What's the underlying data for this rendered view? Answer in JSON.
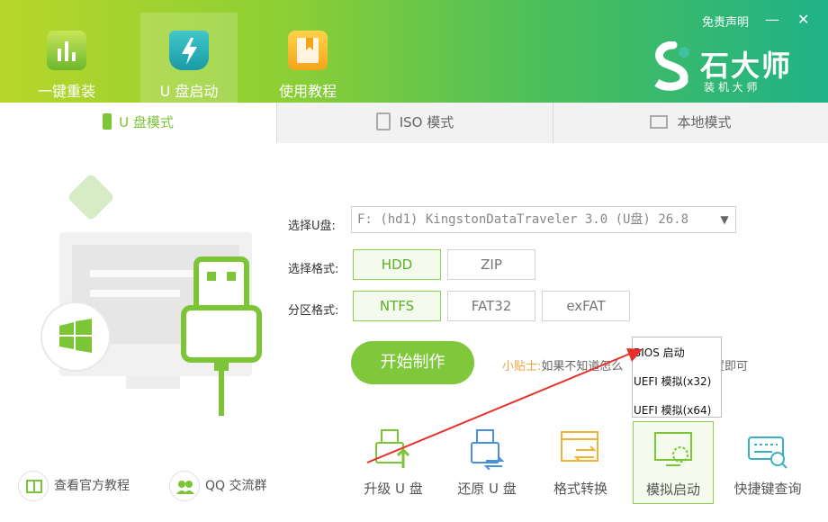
{
  "header": {
    "nav_tabs": [
      {
        "label": "一键重装"
      },
      {
        "label": "U 盘启动"
      },
      {
        "label": "使用教程"
      }
    ],
    "disclaimer": "免责声明",
    "minimize_glyph": "—",
    "close_glyph": "✕",
    "brand_name": "石大师",
    "brand_sub": "装 机 大 师"
  },
  "mode_tabs": [
    {
      "label": "U 盘模式"
    },
    {
      "label": "ISO 模式"
    },
    {
      "label": "本地模式"
    }
  ],
  "form": {
    "drive_label": "选择U盘:",
    "drive_value": "F: (hd1) KingstonDataTraveler 3.0 (U盘) 26.8",
    "format_label": "选择格式:",
    "format_options": [
      "HDD",
      "ZIP"
    ],
    "partition_label": "分区格式:",
    "partition_options": [
      "NTFS",
      "FAT32",
      "exFAT"
    ]
  },
  "start_button": "开始制作",
  "tip": {
    "label": "小贴士:",
    "text": "如果不知道怎么",
    "text_tail": "置即可"
  },
  "dropdown": {
    "items": [
      "BIOS 启动",
      "UEFI 模拟(x32)",
      "UEFI 模拟(x64)"
    ]
  },
  "tools": [
    {
      "label": "升级 U 盘"
    },
    {
      "label": "还原 U 盘"
    },
    {
      "label": "格式转换"
    },
    {
      "label": "模拟启动"
    },
    {
      "label": "快捷键查询"
    }
  ],
  "bottom_links": [
    {
      "label": "查看官方教程"
    },
    {
      "label": "QQ 交流群"
    }
  ],
  "colors": {
    "accent": "#7fc73b",
    "header_start": "#b7d62a",
    "header_end": "#1fb286",
    "tip_label": "#f0a33a",
    "annotation_arrow": "#e8302a"
  }
}
